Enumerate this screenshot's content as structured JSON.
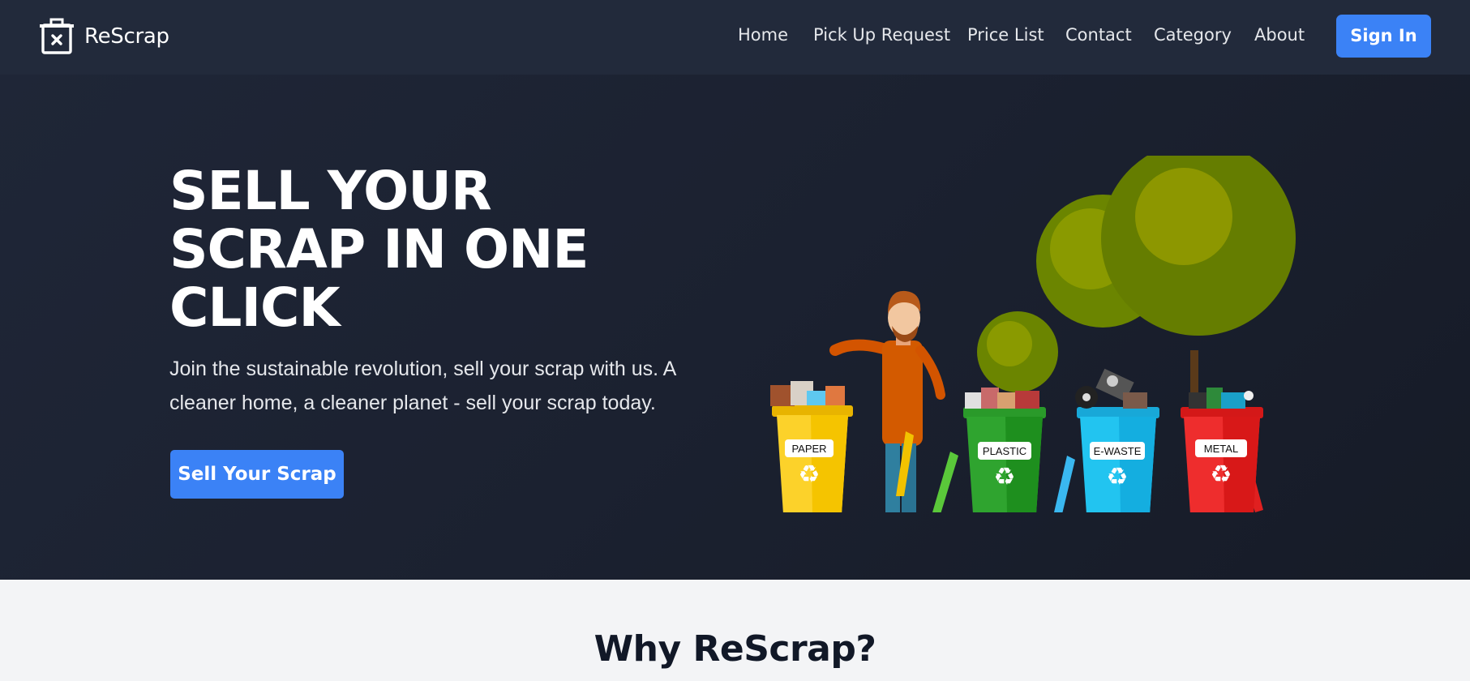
{
  "brand": {
    "name": "ReScrap"
  },
  "nav": {
    "links": [
      "Home",
      "Pick Up Request",
      "Price List",
      "Contact",
      "Category",
      "About"
    ],
    "signin_label": "Sign In"
  },
  "hero": {
    "title_lines": [
      "SELL YOUR",
      "SCRAP IN ONE",
      "CLICK"
    ],
    "subtitle_lines": [
      "Join the sustainable revolution, sell your scrap with us. A",
      "cleaner home, a cleaner planet - sell your scrap today."
    ],
    "cta_label": "Sell Your Scrap",
    "bins": [
      "PAPER",
      "PLASTIC",
      "E-WASTE",
      "METAL"
    ]
  },
  "section": {
    "title": "Why ReScrap?"
  },
  "colors": {
    "navbar_bg": "#222a3b",
    "hero_bg": "#1b2130",
    "accent": "#3b82f6",
    "bin_paper": "#fcd22a",
    "bin_plastic": "#2fa42f",
    "bin_ewaste": "#22c4f0",
    "bin_metal": "#ee2d2d",
    "tree": "#6b8500"
  }
}
